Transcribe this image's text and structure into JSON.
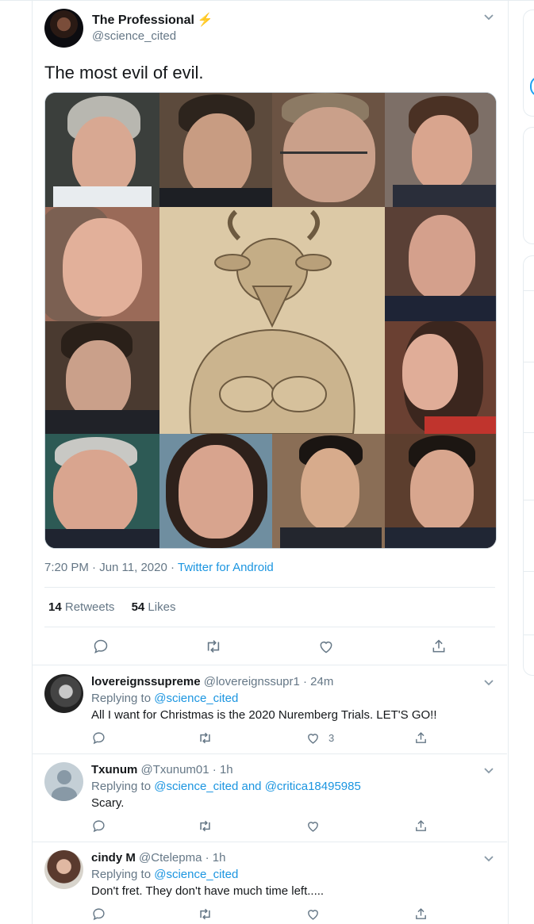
{
  "main_tweet": {
    "author_name": "The Professional",
    "author_badge": "⚡",
    "author_handle": "@science_cited",
    "text": "The most evil of evil.",
    "time": "7:20 PM · Jun 11, 2020",
    "separator": " · ",
    "source": "Twitter for Android",
    "retweets_count": "14",
    "retweets_label": "Retweets",
    "likes_count": "54",
    "likes_label": "Likes"
  },
  "replies": [
    {
      "name": "lovereignssupreme",
      "handle": "@lovereignssupr1 · 24m",
      "replying_label": "Replying to",
      "replying_to": "@science_cited",
      "text": "All I want for Christmas is the 2020 Nuremberg Trials.  LET'S GO!!",
      "like_count": "3"
    },
    {
      "name": "Txunum",
      "handle": "@Txunum01 · 1h",
      "replying_label": "Replying to",
      "replying_to": "@science_cited and @critica18495985",
      "text": "Scary.",
      "like_count": ""
    },
    {
      "name": "cindy M",
      "handle": "@Ctelepma · 1h",
      "replying_label": "Replying to",
      "replying_to": "@science_cited",
      "text": "Don't fret. They don't have much time left.....",
      "like_count": ""
    }
  ],
  "icons": {
    "reply": "reply-icon",
    "retweet": "retweet-icon",
    "like": "heart-icon",
    "share": "share-icon",
    "more": "chevron-down-icon"
  },
  "colors": {
    "link": "#1b95e0",
    "muted": "#657786",
    "border": "#e6ecf0",
    "badge": "#f5a623"
  }
}
